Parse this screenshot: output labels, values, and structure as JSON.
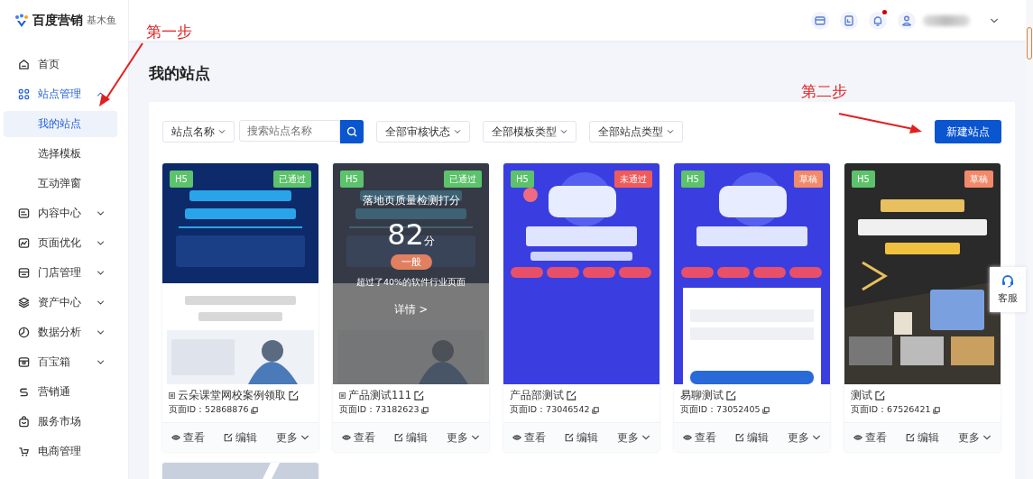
{
  "brand": {
    "name": "百度营销",
    "product": "基木鱼"
  },
  "sidebar": {
    "items": [
      {
        "label": "首页",
        "has_submenu": false,
        "expanded": false,
        "selected": false
      },
      {
        "label": "站点管理",
        "has_submenu": true,
        "expanded": true,
        "selected": false,
        "children": [
          {
            "label": "我的站点",
            "selected": true
          },
          {
            "label": "选择模板",
            "selected": false
          },
          {
            "label": "互动弹窗",
            "selected": false
          }
        ]
      },
      {
        "label": "内容中心",
        "has_submenu": true,
        "expanded": false,
        "selected": false
      },
      {
        "label": "页面优化",
        "has_submenu": true,
        "expanded": false,
        "selected": false
      },
      {
        "label": "门店管理",
        "has_submenu": true,
        "expanded": false,
        "selected": false
      },
      {
        "label": "资产中心",
        "has_submenu": true,
        "expanded": false,
        "selected": false
      },
      {
        "label": "数据分析",
        "has_submenu": true,
        "expanded": false,
        "selected": false
      },
      {
        "label": "百宝箱",
        "has_submenu": true,
        "expanded": false,
        "selected": false
      },
      {
        "label": "营销通",
        "has_submenu": false,
        "expanded": false,
        "selected": false
      },
      {
        "label": "服务市场",
        "has_submenu": false,
        "expanded": false,
        "selected": false
      },
      {
        "label": "电商管理",
        "has_submenu": false,
        "expanded": false,
        "selected": false
      }
    ]
  },
  "header": {
    "notification_dot": true
  },
  "page_title": "我的站点",
  "filters": {
    "field_select": "站点名称",
    "search": {
      "placeholder": "搜索站点名称"
    },
    "dropdowns": [
      "全部审核状态",
      "全部模板类型",
      "全部站点类型"
    ],
    "new_button": "新建站点"
  },
  "cards": [
    {
      "type": "H5",
      "status": {
        "label": "已通过",
        "kind": "passed"
      },
      "prefix_icon": true,
      "name": "云朵课堂网校案例领取",
      "page_id": "页面ID：52868876",
      "actions": [
        "查看",
        "编辑",
        "更多"
      ]
    },
    {
      "type": "H5",
      "status": {
        "label": "已通过",
        "kind": "passed"
      },
      "prefix_icon": true,
      "name": "产品测试111",
      "page_id": "页面ID：73182623",
      "actions": [
        "查看",
        "编辑",
        "更多"
      ],
      "quality": {
        "title": "落地页质量检测打分",
        "score": "82",
        "unit": "分",
        "grade": "一般",
        "note": "超过了40%的软件行业页面",
        "link": "详情 >"
      }
    },
    {
      "type": "H5",
      "status": {
        "label": "未通过",
        "kind": "rejected"
      },
      "prefix_icon": false,
      "name": "产品部测试",
      "page_id": "页面ID：73046542",
      "actions": [
        "查看",
        "编辑",
        "更多"
      ]
    },
    {
      "type": "H5",
      "status": {
        "label": "草稿",
        "kind": "draft"
      },
      "prefix_icon": false,
      "name": "易聊测试",
      "page_id": "页面ID：73052405",
      "actions": [
        "查看",
        "编辑",
        "更多"
      ]
    },
    {
      "type": "H5",
      "status": {
        "label": "草稿",
        "kind": "draft"
      },
      "prefix_icon": false,
      "name": "测试",
      "page_id": "页面ID：67526421",
      "actions": [
        "查看",
        "编辑",
        "更多"
      ]
    }
  ],
  "annotations": [
    {
      "text": "第一步"
    },
    {
      "text": "第二步"
    }
  ],
  "service_button": "客服"
}
